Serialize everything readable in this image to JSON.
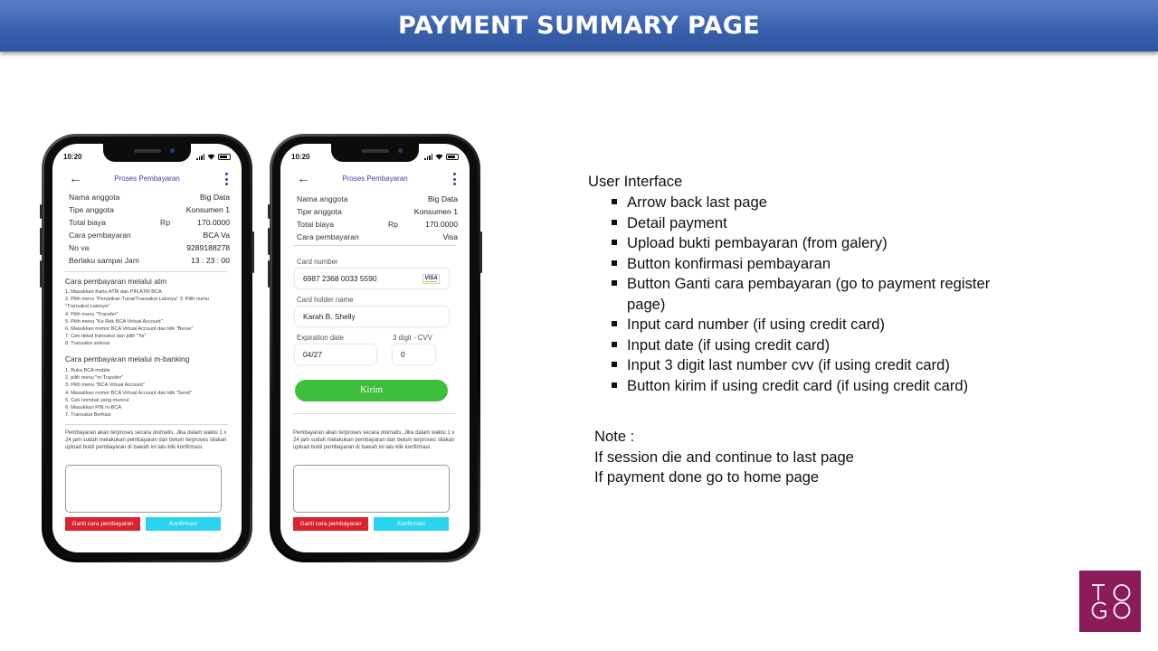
{
  "banner": {
    "title": "PAYMENT SUMMARY PAGE"
  },
  "phone": {
    "status_time": "10:20",
    "appbar_title": "Proses Pembayaran"
  },
  "screen1": {
    "details": [
      {
        "label": "Nama anggota",
        "value": "Big Data"
      },
      {
        "label": "Tipe anggota",
        "value": "Konsumen 1"
      },
      {
        "label": "Total biaya",
        "currency": "Rp",
        "value": "170.0000"
      },
      {
        "label": "Cara pembayaran",
        "value": "BCA Va"
      },
      {
        "label": "No va",
        "value": "9289188278"
      },
      {
        "label": "Berlaku sampai Jam",
        "value": "13 : 23 : 00"
      }
    ],
    "atm_title": "Cara pembayaran melalui atm",
    "atm_steps": [
      "1. Masukkan Kartu ATM dan PIN ATM BCA",
      "2. Pilih menu \"Penarikan Tunai/Transaksi Lainnya\" 3. Pilih menu \"Transaksi Lainnya\"",
      "4. Pilih menu \"Transfer\"",
      "5. Pilih menu \"Ke Rek BCA Virtual Account\"",
      "6. Masukkan nomor BCA Virtual Account dan klik \"Benar\"",
      "7. Cek detail transaksi dan pilih \"Ya\"",
      "8. Transaksi selesai"
    ],
    "mbanking_title": "Cara pembayaran melalui m-banking",
    "mbanking_steps": [
      "1. Buka BCA mobile",
      "2. pilih menu \"m-Transfer\"",
      "3. Pilih menu \"BCA Virtual Account\"",
      "4. Masukkan nomor BCA Virtual Account dan klik \"Send\"",
      "5. Cek nominal yang muncul",
      "6. Masukkan PIN m-BCA",
      "7. Transaksi Berhasi"
    ],
    "note": "Pembayaran akan terproses secara otomatis, Jika dalam waktu 1 x 24 jam sudah melakukan pembayaran dan belum terproses silakan upload bukti pembayaran di bawah ini lalu klik konfirmasi.",
    "btn_ganti": "Ganti cara pembayaran",
    "btn_konfirmasi": "Konfirmasi"
  },
  "screen2": {
    "details": [
      {
        "label": "Nama anggota",
        "value": "Big Data"
      },
      {
        "label": "Tipe anggota",
        "value": "Konsumen 1"
      },
      {
        "label": "Total biaya",
        "currency": "Rp",
        "value": "170.0000"
      },
      {
        "label": "Cara pembayaran",
        "value": "Visa"
      }
    ],
    "card_number_label": "Card number",
    "card_number_value": "6987 2368 0033 5590",
    "card_brand": "VISA",
    "holder_label": "Card holder name",
    "holder_value": "Karah B. Shelly",
    "exp_label": "Expiration date",
    "exp_value": "04/27",
    "cvv_label": "3 digit - CVV",
    "cvv_value": "0",
    "btn_kirim": "Kirim",
    "note": "Pembayaran akan terproses secara otomatis, Jika dalam waktu 1 x 24 jam sudah melakukan pembayaran dan belum terproses silakan upload bukti pembayaran di bawah ini lalu klik konfirmasi.",
    "btn_ganti": "Ganti cara pembayaran",
    "btn_konfirmasi": "Konfirmasi"
  },
  "ui_panel": {
    "heading": "User Interface",
    "items": [
      "Arrow back last page",
      "Detail payment",
      "Upload bukti pembayaran (from galery)",
      "Button konfirmasi  pembayaran",
      "Button Ganti cara pembayaran (go to payment register page)",
      "Input card number (if using credit card)",
      "Input date (if using credit card)",
      "Input 3 digit last number cvv (if using credit card)",
      "Button kirim if using credit card (if using credit card)"
    ]
  },
  "note_panel": {
    "title": "Note :",
    "lines": [
      "If session die and continue to last page",
      "If payment done go to home page"
    ]
  },
  "logo": {
    "letters": [
      "T",
      "O",
      "G",
      "O"
    ],
    "color": "#8c1c57"
  }
}
